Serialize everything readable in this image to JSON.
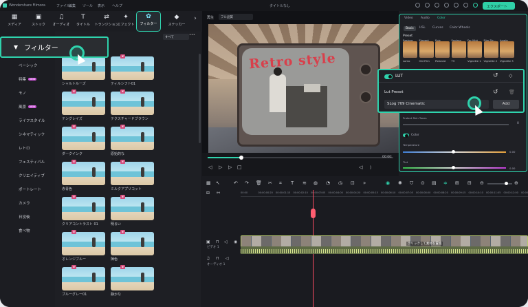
{
  "app": {
    "name": "Wondershare Filmora",
    "project_title": "タイトルなし",
    "menu": [
      "ファイル",
      "編集",
      "ツール",
      "表示",
      "ヘルプ"
    ],
    "export_label": "エクスポート"
  },
  "toolbar": {
    "items": [
      {
        "label": "メディア",
        "icon": "media-icon"
      },
      {
        "label": "ストック",
        "icon": "stock-icon"
      },
      {
        "label": "オーディオ",
        "icon": "music-icon"
      },
      {
        "label": "タイトル",
        "icon": "title-icon"
      },
      {
        "label": "トランジション",
        "icon": "transition-icon"
      },
      {
        "label": "エフェクト",
        "icon": "effect-icon"
      },
      {
        "label": "フィルター",
        "icon": "filter-icon",
        "active": true
      },
      {
        "label": "ステッカー",
        "icon": "sticker-icon"
      }
    ]
  },
  "callout": {
    "label": "フィルター"
  },
  "sidebar": {
    "categories": [
      "ベーシック",
      "特集",
      "モノ",
      "風景",
      "ライフスタイル",
      "シネマティック",
      "レトロ",
      "フェスティバル",
      "クリエイティブ",
      "ポートレート",
      "カメラ",
      "日没後",
      "食べ物"
    ],
    "tags": {
      "特集": "NEW",
      "風景": "NEW"
    }
  },
  "filter_header": {
    "dropdown": "すべて",
    "more": "•••"
  },
  "filters": [
    [
      "シャルトルーズ",
      "ティルシフト01"
    ],
    [
      "テングレイズ",
      "テクスチャードブラウン"
    ],
    [
      "ダークインク",
      "原始的な"
    ],
    [
      "赤青色",
      "ミルクアプリコット"
    ],
    [
      "クリアコントラスト 01",
      "明るい"
    ],
    [
      "オレンジブルー",
      "陳色"
    ],
    [
      "ブルーグレー01",
      "静かな"
    ]
  ],
  "player": {
    "quality_label": "再生",
    "quality_value": "フル品質",
    "overlay_text": "Retro style",
    "timecode": "00:00:"
  },
  "color_panel": {
    "top_tabs": [
      "Video",
      "Audio",
      "Color"
    ],
    "sub_tabs": [
      "Basic",
      "HSL",
      "Curves",
      "Color Wheels"
    ],
    "section": "Preset",
    "presets": [
      "Restore",
      "Elegant",
      "Epic",
      "Fantasy",
      "For Mist",
      "Film Str...",
      "Jungle"
    ],
    "preset_sub": [
      "Lomo",
      "Old Film",
      "Polaroid",
      "TV",
      "Vignette 1",
      "Vignette 2",
      "Vignette 3"
    ],
    "protect_label": "Protect Skin Tones",
    "protect_value": "0",
    "color_label": "Color",
    "temperature_label": "Temperature",
    "temperature_value": "0.00",
    "tint_label": "Tint",
    "tint_value": "0.00"
  },
  "lut": {
    "title": "LUT",
    "preset_label": "Lut Preset",
    "selected": "SLog 709 Cinematic",
    "add_label": "Add"
  },
  "timeline": {
    "ruler": [
      "00:00",
      "00:00:00:20",
      "00:00:01:15",
      "00:00:02:10",
      "00:00:03:05",
      "00:00:04:00",
      "00:00:04:20",
      "00:00:05:15",
      "00:00:06:10",
      "00:00:07:05",
      "00:00:08:00",
      "00:00:08:20",
      "00:00:09:15",
      "00:00:10:10",
      "00:00:11:05",
      "00:00:12:00",
      "00:00:13:15"
    ],
    "video_label": "ビデオ 1",
    "audio_label": "オーディオ 1",
    "clip_caption": "クリックして素材を置換"
  }
}
